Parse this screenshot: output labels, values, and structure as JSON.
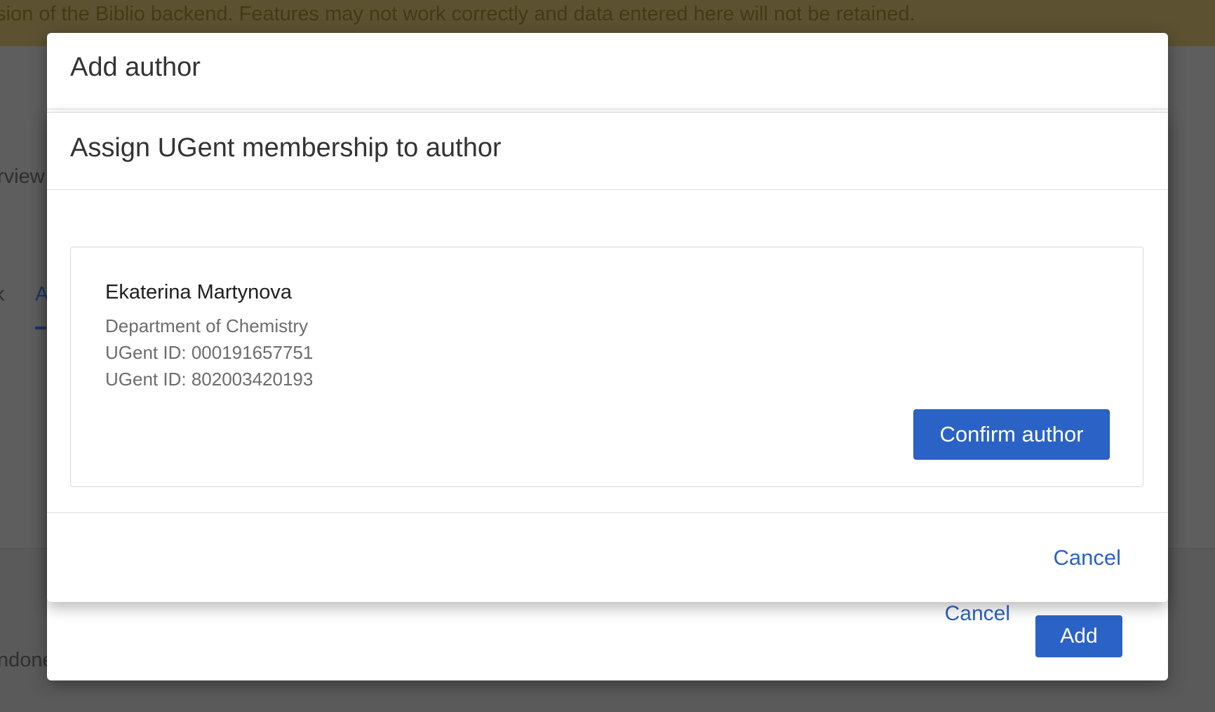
{
  "background": {
    "banner_text": "sion of the Biblio backend. Features may not work correctly and data entered here will not be retained.",
    "fragment_overview": "rview",
    "fragment_tab": "A",
    "fragment_k": "k",
    "fragment_bottom": "ndone"
  },
  "outer_modal": {
    "title": "Add author",
    "cancel_label": "Cancel",
    "add_label": "Add"
  },
  "inner_modal": {
    "title": "Assign UGent membership to author",
    "author": {
      "name": "Ekaterina Martynova",
      "department": "Department of Chemistry",
      "ugent_ids": [
        "UGent ID: 000191657751",
        "UGent ID: 802003420193"
      ]
    },
    "confirm_label": "Confirm author",
    "cancel_label": "Cancel"
  },
  "colors": {
    "primary": "#2b62c6",
    "overlay": "#5a5a5a",
    "banner": "#5c5232"
  }
}
